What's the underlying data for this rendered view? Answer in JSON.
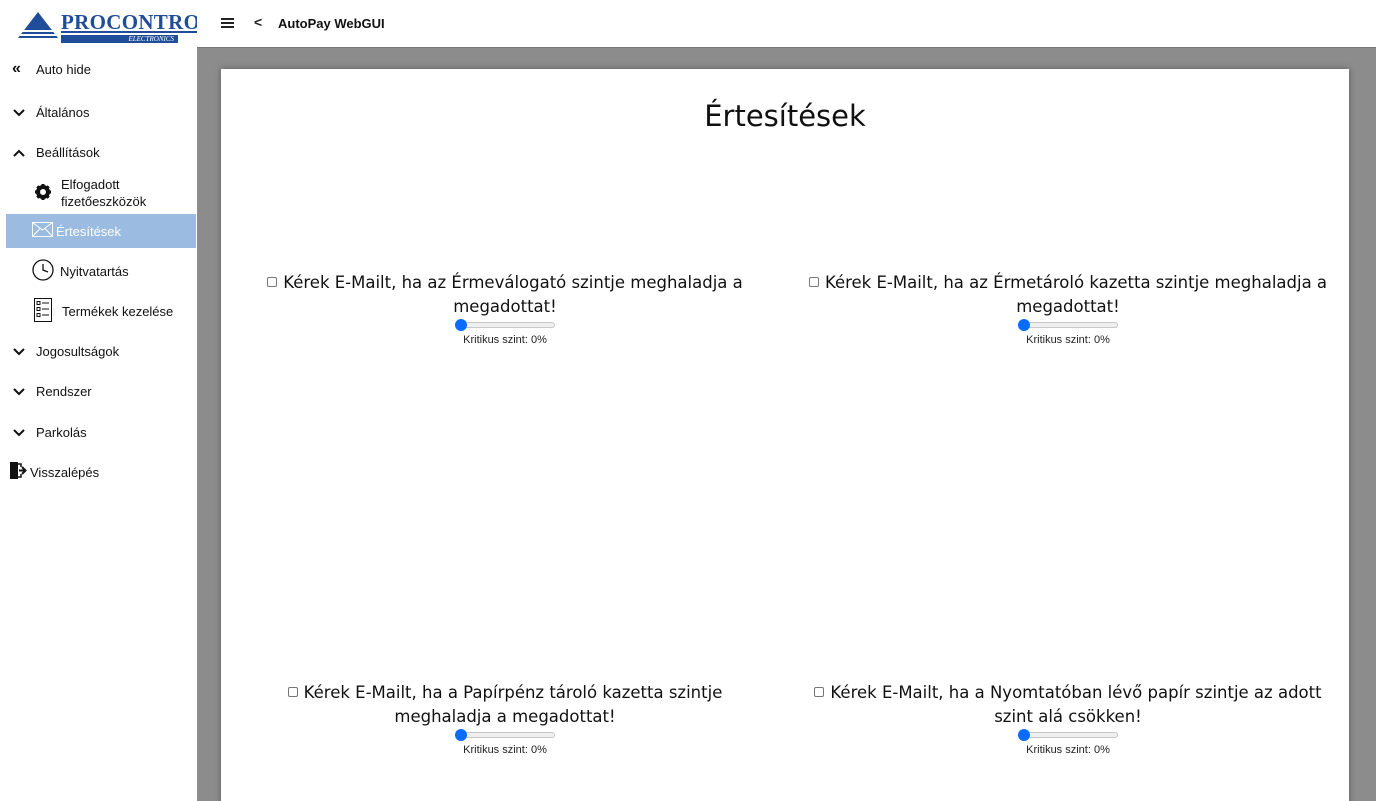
{
  "logo": {
    "brand": "PROCONTROL",
    "registered": "®",
    "sub": "ELECTRONICS"
  },
  "header": {
    "title": "AutoPay WebGUI"
  },
  "sidebar": {
    "auto_hide": "Auto hide",
    "items": [
      {
        "label": "Általános"
      },
      {
        "label": "Beállítások"
      },
      {
        "label_l1": "Elfogadott",
        "label_l2": "fizetőeszközök"
      },
      {
        "label": "Értesítések"
      },
      {
        "label": "Nyitvatartás"
      },
      {
        "label": "Termékek kezelése"
      },
      {
        "label": "Jogosultságok"
      },
      {
        "label": "Rendszer"
      },
      {
        "label": "Parkolás"
      },
      {
        "label": "Visszalépés"
      }
    ]
  },
  "main": {
    "title": "Értesítések",
    "options": [
      {
        "line1": "Kérek E-Mailt, ha az Érmeválogató szintje meghaladja a",
        "line2": "megadottat!",
        "checked": false,
        "level": 0,
        "status": "Kritikus szint: 0%"
      },
      {
        "line1": "Kérek E-Mailt, ha az Érmetároló kazetta szintje meghaladja a",
        "line2": "megadottat!",
        "checked": false,
        "level": 0,
        "status": "Kritikus szint: 0%"
      },
      {
        "line1": "Kérek E-Mailt, ha a Papírpénz tároló kazetta szintje",
        "line2": "meghaladja a megadottat!",
        "checked": false,
        "level": 0,
        "status": "Kritikus szint: 0%"
      },
      {
        "line1": "Kérek E-Mailt, ha a Nyomtatóban lévő papír szintje az adott",
        "line2": "szint alá csökken!",
        "checked": false,
        "level": 0,
        "status": "Kritikus szint: 0%"
      }
    ]
  },
  "colors": {
    "brand": "#1f4d9a",
    "active_item": "#9bbbe0",
    "slider_thumb": "#0a6cff",
    "backdrop": "#8c8c8c"
  }
}
